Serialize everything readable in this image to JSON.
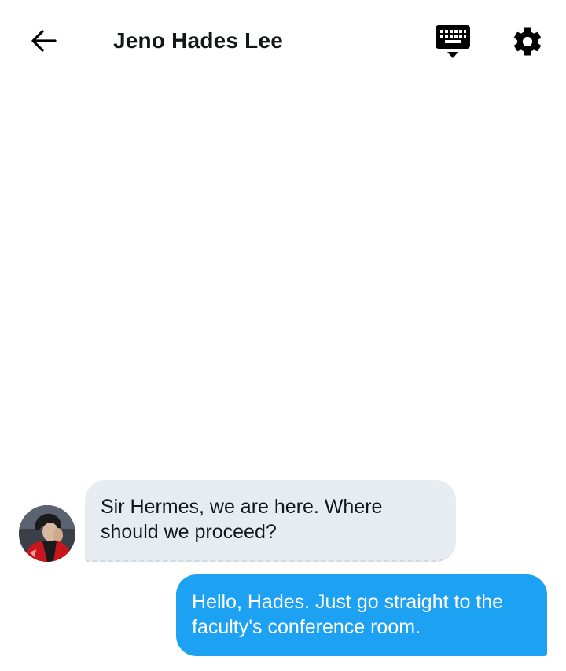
{
  "header": {
    "title": "Jeno Hades Lee",
    "back_icon": "arrow-left-icon",
    "keyboard_icon": "keyboard-hide-icon",
    "settings_icon": "gear-icon"
  },
  "messages": [
    {
      "direction": "incoming",
      "text": "Sir Hermes, we are here. Where should we proceed?",
      "avatar": "avatar"
    },
    {
      "direction": "outgoing",
      "text": "Hello, Hades. Just go straight to the faculty's conference room."
    }
  ],
  "colors": {
    "incoming_bubble": "#e6ecf0",
    "outgoing_bubble": "#1da1f2",
    "text": "#14171a",
    "outgoing_text": "#ffffff"
  }
}
